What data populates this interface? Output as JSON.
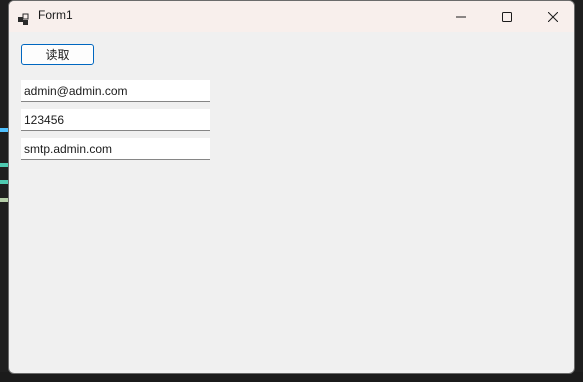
{
  "window": {
    "title": "Form1",
    "icons": {
      "app": "app-icon",
      "minimize": "minimize-icon",
      "maximize": "maximize-icon",
      "close": "close-icon"
    }
  },
  "form": {
    "read_button_label": "读取",
    "fields": {
      "email": "admin@admin.com",
      "password": "123456",
      "smtp_server": "smtp.admin.com"
    }
  },
  "colors": {
    "titlebar": "#f8efec",
    "client": "#f0f0f0",
    "button_border": "#0067c0"
  }
}
